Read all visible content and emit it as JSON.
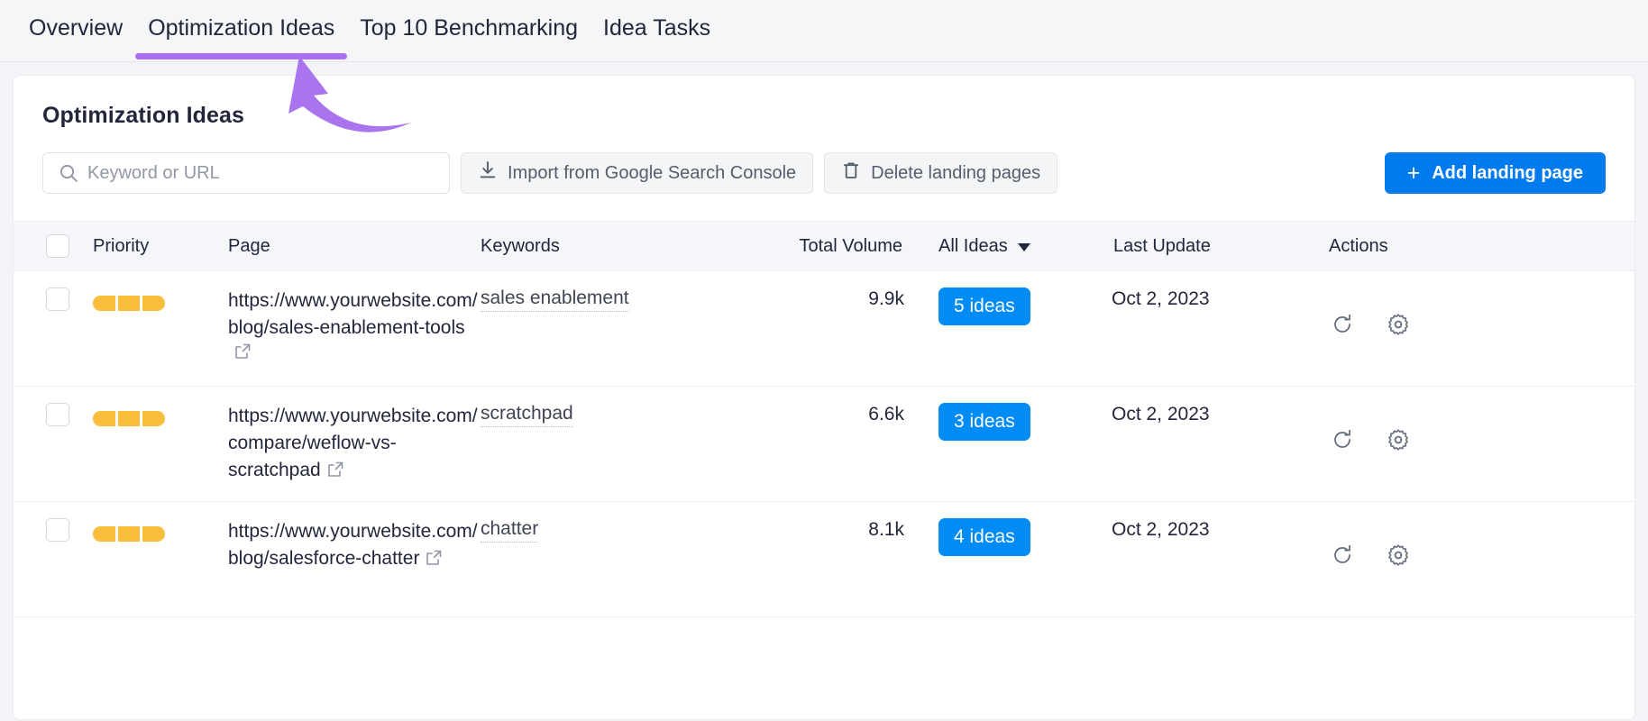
{
  "tabs": [
    {
      "label": "Overview",
      "active": false
    },
    {
      "label": "Optimization Ideas",
      "active": true
    },
    {
      "label": "Top 10 Benchmarking",
      "active": false
    },
    {
      "label": "Idea Tasks",
      "active": false
    }
  ],
  "card": {
    "title": "Optimization Ideas"
  },
  "toolbar": {
    "search_placeholder": "Keyword or URL",
    "search_value": "",
    "import_label": "Import from Google Search Console",
    "delete_label": "Delete landing pages",
    "add_label": "Add landing page",
    "add_plus": "+"
  },
  "table": {
    "headers": {
      "priority": "Priority",
      "page": "Page",
      "keywords": "Keywords",
      "total_volume": "Total Volume",
      "ideas_filter": "All Ideas",
      "last_update": "Last Update",
      "actions": "Actions"
    },
    "rows": [
      {
        "priority_segments": 3,
        "page": "https://www.yourwebsite.com/blog/sales-enablement-tools",
        "keyword": "sales enablement",
        "volume": "9.9k",
        "ideas": "5 ideas",
        "last_update": "Oct 2, 2023"
      },
      {
        "priority_segments": 3,
        "page": "https://www.yourwebsite.com/compare/weflow-vs-scratchpad",
        "keyword": "scratchpad",
        "volume": "6.6k",
        "ideas": "3 ideas",
        "last_update": "Oct 2, 2023"
      },
      {
        "priority_segments": 3,
        "page": "https://www.yourwebsite.com/blog/salesforce-chatter",
        "keyword": "chatter",
        "volume": "8.1k",
        "ideas": "4 ideas",
        "last_update": "Oct 2, 2023"
      }
    ]
  },
  "annotation": {
    "arrow_color": "#ab74ef"
  },
  "colors": {
    "accent_blue": "#007bef",
    "badge_blue": "#008bf5",
    "priority_yellow": "#f9bf3b",
    "tab_underline_purple": "#a96ff0"
  }
}
